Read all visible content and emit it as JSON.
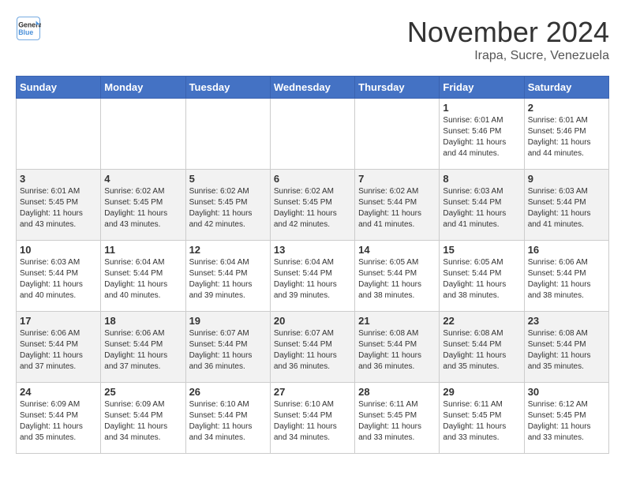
{
  "header": {
    "logo_line1": "General",
    "logo_line2": "Blue",
    "month": "November 2024",
    "location": "Irapa, Sucre, Venezuela"
  },
  "weekdays": [
    "Sunday",
    "Monday",
    "Tuesday",
    "Wednesday",
    "Thursday",
    "Friday",
    "Saturday"
  ],
  "weeks": [
    [
      {
        "day": "",
        "info": ""
      },
      {
        "day": "",
        "info": ""
      },
      {
        "day": "",
        "info": ""
      },
      {
        "day": "",
        "info": ""
      },
      {
        "day": "",
        "info": ""
      },
      {
        "day": "1",
        "info": "Sunrise: 6:01 AM\nSunset: 5:46 PM\nDaylight: 11 hours and 44 minutes."
      },
      {
        "day": "2",
        "info": "Sunrise: 6:01 AM\nSunset: 5:46 PM\nDaylight: 11 hours and 44 minutes."
      }
    ],
    [
      {
        "day": "3",
        "info": "Sunrise: 6:01 AM\nSunset: 5:45 PM\nDaylight: 11 hours and 43 minutes."
      },
      {
        "day": "4",
        "info": "Sunrise: 6:02 AM\nSunset: 5:45 PM\nDaylight: 11 hours and 43 minutes."
      },
      {
        "day": "5",
        "info": "Sunrise: 6:02 AM\nSunset: 5:45 PM\nDaylight: 11 hours and 42 minutes."
      },
      {
        "day": "6",
        "info": "Sunrise: 6:02 AM\nSunset: 5:45 PM\nDaylight: 11 hours and 42 minutes."
      },
      {
        "day": "7",
        "info": "Sunrise: 6:02 AM\nSunset: 5:44 PM\nDaylight: 11 hours and 41 minutes."
      },
      {
        "day": "8",
        "info": "Sunrise: 6:03 AM\nSunset: 5:44 PM\nDaylight: 11 hours and 41 minutes."
      },
      {
        "day": "9",
        "info": "Sunrise: 6:03 AM\nSunset: 5:44 PM\nDaylight: 11 hours and 41 minutes."
      }
    ],
    [
      {
        "day": "10",
        "info": "Sunrise: 6:03 AM\nSunset: 5:44 PM\nDaylight: 11 hours and 40 minutes."
      },
      {
        "day": "11",
        "info": "Sunrise: 6:04 AM\nSunset: 5:44 PM\nDaylight: 11 hours and 40 minutes."
      },
      {
        "day": "12",
        "info": "Sunrise: 6:04 AM\nSunset: 5:44 PM\nDaylight: 11 hours and 39 minutes."
      },
      {
        "day": "13",
        "info": "Sunrise: 6:04 AM\nSunset: 5:44 PM\nDaylight: 11 hours and 39 minutes."
      },
      {
        "day": "14",
        "info": "Sunrise: 6:05 AM\nSunset: 5:44 PM\nDaylight: 11 hours and 38 minutes."
      },
      {
        "day": "15",
        "info": "Sunrise: 6:05 AM\nSunset: 5:44 PM\nDaylight: 11 hours and 38 minutes."
      },
      {
        "day": "16",
        "info": "Sunrise: 6:06 AM\nSunset: 5:44 PM\nDaylight: 11 hours and 38 minutes."
      }
    ],
    [
      {
        "day": "17",
        "info": "Sunrise: 6:06 AM\nSunset: 5:44 PM\nDaylight: 11 hours and 37 minutes."
      },
      {
        "day": "18",
        "info": "Sunrise: 6:06 AM\nSunset: 5:44 PM\nDaylight: 11 hours and 37 minutes."
      },
      {
        "day": "19",
        "info": "Sunrise: 6:07 AM\nSunset: 5:44 PM\nDaylight: 11 hours and 36 minutes."
      },
      {
        "day": "20",
        "info": "Sunrise: 6:07 AM\nSunset: 5:44 PM\nDaylight: 11 hours and 36 minutes."
      },
      {
        "day": "21",
        "info": "Sunrise: 6:08 AM\nSunset: 5:44 PM\nDaylight: 11 hours and 36 minutes."
      },
      {
        "day": "22",
        "info": "Sunrise: 6:08 AM\nSunset: 5:44 PM\nDaylight: 11 hours and 35 minutes."
      },
      {
        "day": "23",
        "info": "Sunrise: 6:08 AM\nSunset: 5:44 PM\nDaylight: 11 hours and 35 minutes."
      }
    ],
    [
      {
        "day": "24",
        "info": "Sunrise: 6:09 AM\nSunset: 5:44 PM\nDaylight: 11 hours and 35 minutes."
      },
      {
        "day": "25",
        "info": "Sunrise: 6:09 AM\nSunset: 5:44 PM\nDaylight: 11 hours and 34 minutes."
      },
      {
        "day": "26",
        "info": "Sunrise: 6:10 AM\nSunset: 5:44 PM\nDaylight: 11 hours and 34 minutes."
      },
      {
        "day": "27",
        "info": "Sunrise: 6:10 AM\nSunset: 5:44 PM\nDaylight: 11 hours and 34 minutes."
      },
      {
        "day": "28",
        "info": "Sunrise: 6:11 AM\nSunset: 5:45 PM\nDaylight: 11 hours and 33 minutes."
      },
      {
        "day": "29",
        "info": "Sunrise: 6:11 AM\nSunset: 5:45 PM\nDaylight: 11 hours and 33 minutes."
      },
      {
        "day": "30",
        "info": "Sunrise: 6:12 AM\nSunset: 5:45 PM\nDaylight: 11 hours and 33 minutes."
      }
    ]
  ]
}
